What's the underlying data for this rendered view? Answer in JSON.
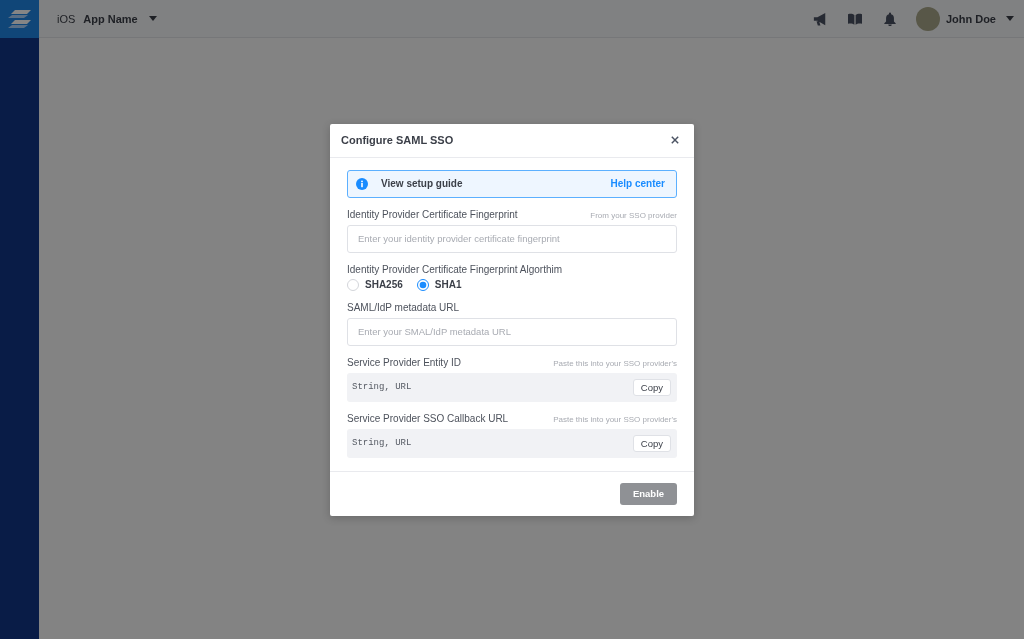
{
  "top_bar": {
    "platform": "iOS",
    "app_name": "App Name",
    "user_name": "John Doe"
  },
  "dialog": {
    "title": "Configure SAML SSO",
    "info_banner": {
      "text": "View setup guide",
      "link": "Help center"
    },
    "fields": [
      {
        "kind": "input",
        "label": "Identity Provider Certificate Fingerprint",
        "hint": "From your SSO provider",
        "placeholder": "Enter your identity provider certificate fingerprint"
      },
      {
        "kind": "radio",
        "label": "Identity Provider Certificate Fingerprint Algorthim",
        "options": [
          {
            "label": "SHA256",
            "selected": false
          },
          {
            "label": "SHA1",
            "selected": true
          }
        ]
      },
      {
        "kind": "input",
        "label": "SAML/IdP metadata URL",
        "placeholder": "Enter your SMAL/IdP metadata URL"
      },
      {
        "kind": "copy",
        "label": "Service Provider Entity ID",
        "hint": "Paste this into your SSO provider's",
        "value": "String, URL",
        "button": "Copy"
      },
      {
        "kind": "copy",
        "label": "Service Provider SSO Callback URL",
        "hint": "Paste this into your SSO provider's",
        "value": "String, URL",
        "button": "Copy"
      }
    ],
    "footer": {
      "button": {
        "label": "Enable",
        "disabled": true
      }
    }
  }
}
